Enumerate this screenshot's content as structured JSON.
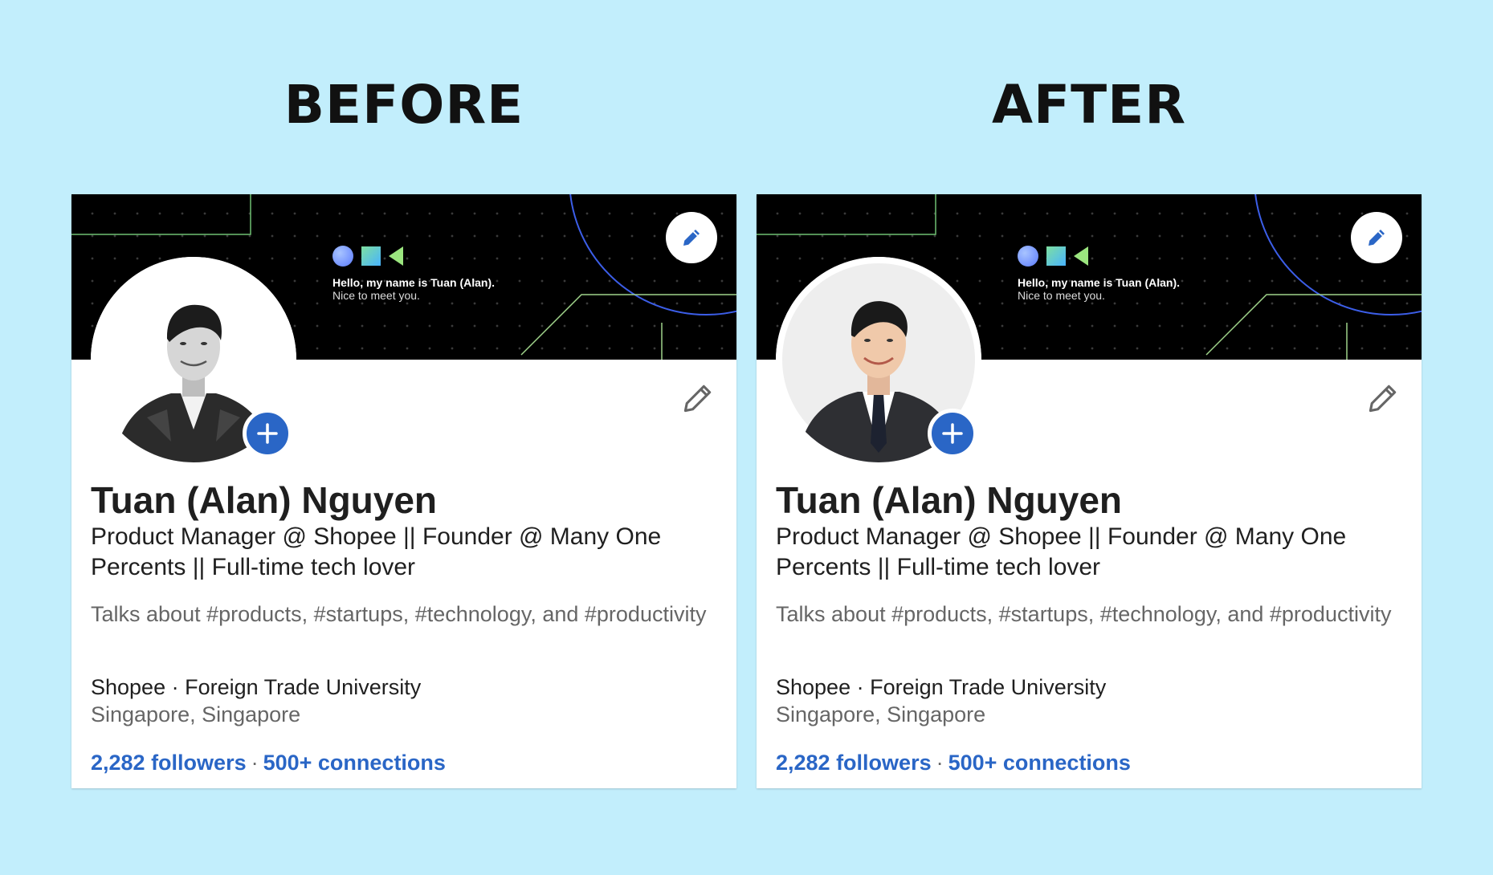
{
  "before": {
    "heading": "BEFORE"
  },
  "after": {
    "heading": "AFTER"
  },
  "profile": {
    "banner_line1": "Hello, my name is Tuan (Alan).",
    "banner_line2": "Nice to meet you.",
    "name": "Tuan (Alan) Nguyen",
    "headline": "Product Manager @ Shopee || Founder @ Many One Percents || Full-time tech lover",
    "talks_about": "Talks about #products, #startups, #technology, and #productivity",
    "experience": "Shopee · Foreign Trade University",
    "location": "Singapore, Singapore",
    "followers": "2,282 followers",
    "separator": "·",
    "connections": "500+ connections"
  },
  "colors": {
    "page_bg": "#c2eefc",
    "link_blue": "#2a66c6",
    "banner_bg": "#000000"
  }
}
